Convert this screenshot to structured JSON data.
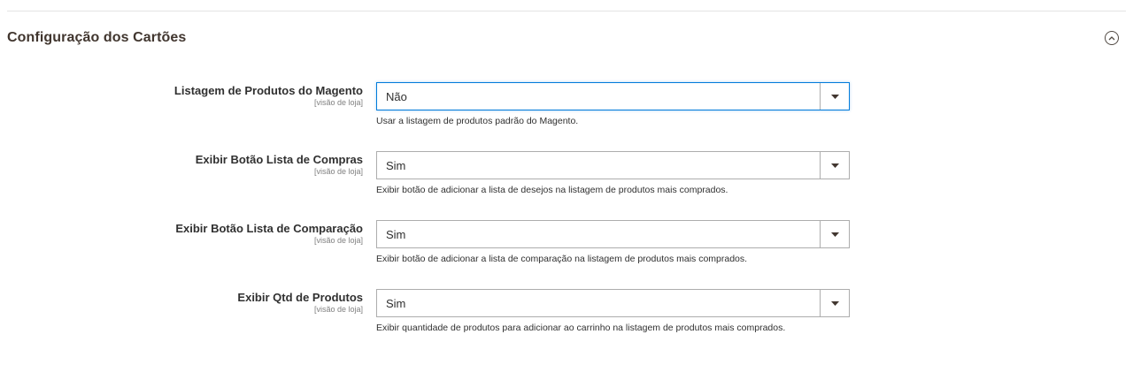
{
  "section": {
    "title": "Configuração dos Cartões",
    "toggle_icon": "chevron-up-circle-icon"
  },
  "fields": [
    {
      "label": "Listagem de Produtos do Magento",
      "scope": "[visão de loja]",
      "value": "Não",
      "note": "Usar a listagem de produtos padrão do Magento."
    },
    {
      "label": "Exibir Botão Lista de Compras",
      "scope": "[visão de loja]",
      "value": "Sim",
      "note": "Exibir botão de adicionar a lista de desejos na listagem de produtos mais comprados."
    },
    {
      "label": "Exibir Botão Lista de Comparação",
      "scope": "[visão de loja]",
      "value": "Sim",
      "note": "Exibir botão de adicionar a lista de comparação na listagem de produtos mais comprados."
    },
    {
      "label": "Exibir Qtd de Produtos",
      "scope": "[visão de loja]",
      "value": "Sim",
      "note": "Exibir quantidade de produtos para adicionar ao carrinho na listagem de produtos mais comprados."
    }
  ],
  "colors": {
    "focus_border": "#007bdb",
    "select_border": "#adadad",
    "title_text": "#41362f"
  }
}
